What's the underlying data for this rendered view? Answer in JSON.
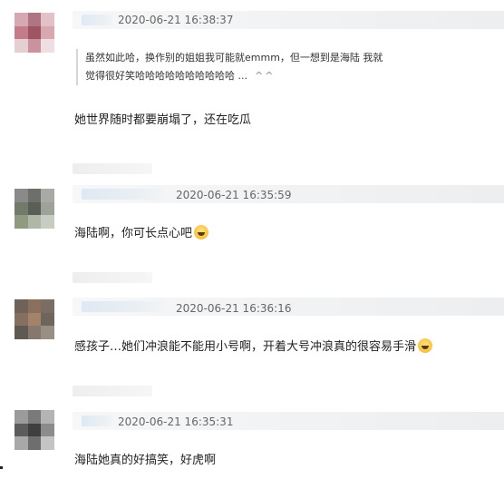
{
  "comments": [
    {
      "timestamp": "2020-06-21 16:38:37",
      "quote": {
        "line1": "虽然如此哈，换作别的姐姐我可能就emmm，但一想到是海陆 我就",
        "line2": "觉得很好笑哈哈哈哈哈哈哈哈哈哈 ...",
        "toggle": "^^"
      },
      "text": "她世界随时都要崩塌了，还在吃瓜",
      "has_emoji": false
    },
    {
      "timestamp": "2020-06-21 16:35:59",
      "text": "海陆啊，你可长点心吧",
      "has_emoji": true
    },
    {
      "timestamp": "2020-06-21 16:36:16",
      "text": "感孩子…她们冲浪能不能用小号啊，开着大号冲浪真的很容易手滑",
      "has_emoji": true
    },
    {
      "timestamp": "2020-06-21 16:35:31",
      "text": "海陆她真的好搞笑，好虎啊",
      "has_emoji": false
    }
  ],
  "icons": {
    "emoji": "grinning-face-emoji"
  },
  "colors": {
    "timestamp": "#666666",
    "text": "#222222",
    "blur_name": "#dfe9f3"
  }
}
